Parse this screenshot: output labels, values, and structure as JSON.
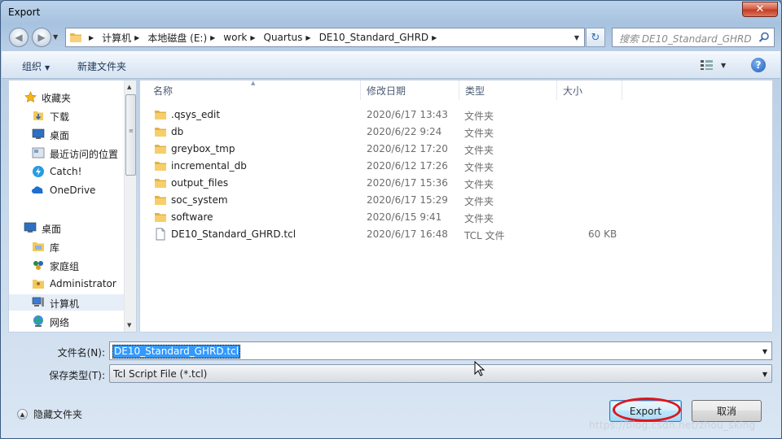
{
  "window": {
    "title": "Export",
    "close_glyph": "✕"
  },
  "address": {
    "crumbs": [
      "计算机",
      "本地磁盘 (E:)",
      "work",
      "Quartus",
      "DE10_Standard_GHRD"
    ],
    "search_placeholder": "搜索 DE10_Standard_GHRD"
  },
  "toolbar": {
    "organize": "组织",
    "new_folder": "新建文件夹"
  },
  "nav": {
    "items": [
      {
        "label": "收藏夹",
        "icon": "star-icon"
      },
      {
        "label": "下载",
        "icon": "download-folder-icon"
      },
      {
        "label": "桌面",
        "icon": "desktop-icon"
      },
      {
        "label": "最近访问的位置",
        "icon": "recent-places-icon"
      },
      {
        "label": "Catch!",
        "icon": "catch-icon"
      },
      {
        "label": "OneDrive",
        "icon": "onedrive-icon"
      },
      {
        "label": "桌面",
        "icon": "desktop-icon"
      },
      {
        "label": "库",
        "icon": "library-icon"
      },
      {
        "label": "家庭组",
        "icon": "homegroup-icon"
      },
      {
        "label": "Administrator",
        "icon": "user-folder-icon"
      },
      {
        "label": "计算机",
        "icon": "computer-icon"
      },
      {
        "label": "网络",
        "icon": "network-icon"
      }
    ],
    "selected": "计算机"
  },
  "columns": {
    "name": "名称",
    "date": "修改日期",
    "type": "类型",
    "size": "大小"
  },
  "files": [
    {
      "name": ".qsys_edit",
      "date": "2020/6/17 13:43",
      "type": "文件夹",
      "size": "",
      "icon": "folder-icon"
    },
    {
      "name": "db",
      "date": "2020/6/22 9:24",
      "type": "文件夹",
      "size": "",
      "icon": "folder-icon"
    },
    {
      "name": "greybox_tmp",
      "date": "2020/6/12 17:20",
      "type": "文件夹",
      "size": "",
      "icon": "folder-icon"
    },
    {
      "name": "incremental_db",
      "date": "2020/6/12 17:26",
      "type": "文件夹",
      "size": "",
      "icon": "folder-icon"
    },
    {
      "name": "output_files",
      "date": "2020/6/17 15:36",
      "type": "文件夹",
      "size": "",
      "icon": "folder-icon"
    },
    {
      "name": "soc_system",
      "date": "2020/6/17 15:29",
      "type": "文件夹",
      "size": "",
      "icon": "folder-icon"
    },
    {
      "name": "software",
      "date": "2020/6/15 9:41",
      "type": "文件夹",
      "size": "",
      "icon": "folder-icon"
    },
    {
      "name": "DE10_Standard_GHRD.tcl",
      "date": "2020/6/17 16:48",
      "type": "TCL 文件",
      "size": "60 KB",
      "icon": "file-icon"
    }
  ],
  "form": {
    "filename_label": "文件名(N):",
    "filename_value": "DE10_Standard_GHRD.tcl",
    "filetype_label": "保存类型(T):",
    "filetype_value": "Tcl Script File (*.tcl)"
  },
  "footer": {
    "hide_folders": "隐藏文件夹",
    "export_button": "Export",
    "cancel_button": "取消",
    "watermark": "https://blog.csdn.net/zhou_sking"
  },
  "colors": {
    "selection": "#3399ff",
    "annotation_ring": "#e0141e",
    "folder": "#f3c95b"
  }
}
